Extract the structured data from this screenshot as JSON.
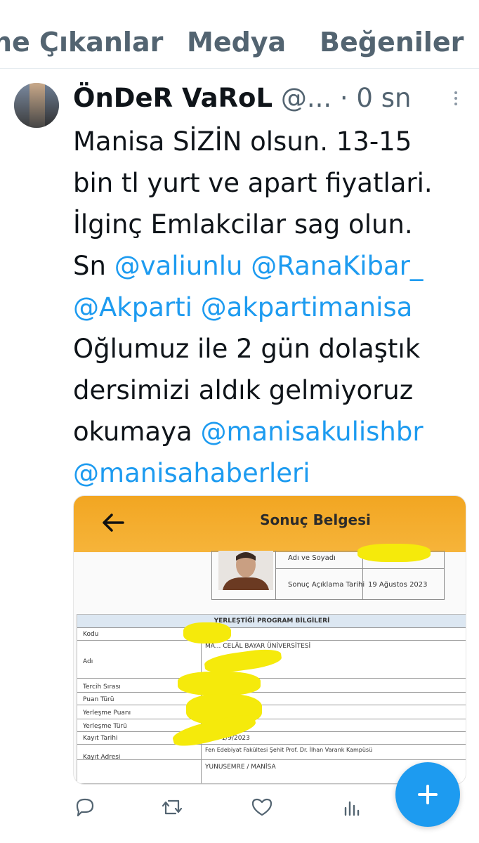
{
  "tabs": [
    "ne Çıkanlar",
    "Medya",
    "Beğeniler"
  ],
  "tweet": {
    "author_name": "ÖnDeR VaRoL",
    "handle": "@...",
    "separator": "·",
    "time": "0 sn",
    "text_plain_1": "Manisa SİZİN olsun. 13-15\nbin tl yurt ve apart fiyatlari.\nİlginç Emlakcilar sag olun.\nSn ",
    "mention_1": "@valiunlu",
    "mention_2": "@RanaKibar_",
    "mention_3": "@Akparti",
    "mention_4": "@akpartimanisa",
    "text_plain_2": "\nOğlumuz ile 2 gün dolaştık\ndersimizi aldık gelmiyoruz\nokumaya ",
    "mention_5": "@manisakulishbr",
    "mention_6": "@manisahaberleri"
  },
  "card": {
    "title": "Sonuç Belgesi",
    "name_label": "Adı ve Soyadı",
    "result_date_label": "Sonuç Açıklama Tarihi",
    "result_date": "19 Ağustos 2023",
    "program_header": "YERLEŞTİĞİ PROGRAM BİLGİLERİ",
    "rows": {
      "kodu": "Kodu",
      "adi": "Adı",
      "tercih": "Tercih Sırası",
      "puan_turu": "Puan Türü",
      "yerlesme_puani": "Yerleşme Puanı",
      "yerlesme_turu": "Yerleşme Türü",
      "kayit_tarihi": "Kayıt Tarihi",
      "kayit_adresi": "Kayıt Adresi"
    },
    "university": "MA... CELÂL BAYAR ÜNİVERSİTESİ",
    "kayit_tarihi_val": "28/8-1/9/2023",
    "address_1": "Fen Edebiyat Fakültesi Şehit Prof. Dr. İlhan Varank Kampüsü",
    "address_2": "YUNUSEMRE / MANİSA"
  },
  "icons": {
    "reply": "reply-icon",
    "retweet": "retweet-icon",
    "like": "heart-icon",
    "views": "views-icon",
    "compose": "plus-icon"
  },
  "colors": {
    "accent": "#1d9bf0",
    "header_orange": "#f2a622",
    "redaction": "#f5ea0b"
  }
}
